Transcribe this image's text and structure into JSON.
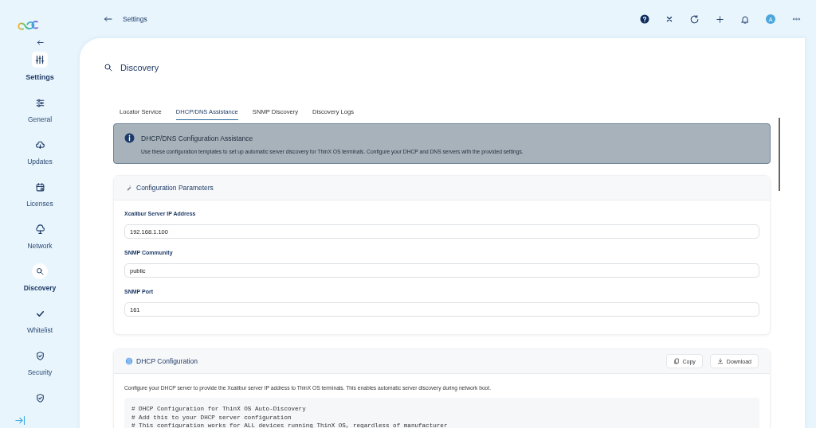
{
  "topbar": {
    "title": "Settings",
    "avatar": "A"
  },
  "sidebar": {
    "heading": "Settings",
    "items": [
      {
        "label": "General",
        "selected": false
      },
      {
        "label": "Updates",
        "selected": false
      },
      {
        "label": "Licenses",
        "selected": false
      },
      {
        "label": "Network",
        "selected": false
      },
      {
        "label": "Discovery",
        "selected": true
      },
      {
        "label": "Whitelist",
        "selected": false
      },
      {
        "label": "Security",
        "selected": false
      },
      {
        "selected": false
      }
    ]
  },
  "page": {
    "title": "Discovery"
  },
  "tabs": [
    {
      "label": "Locator Service",
      "selected": false
    },
    {
      "label": "DHCP/DNS Assistance",
      "selected": true
    },
    {
      "label": "SNMP Discovery",
      "selected": false
    },
    {
      "label": "Discovery Logs",
      "selected": false
    }
  ],
  "banner": {
    "title": "DHCP/DNS Configuration Assistance",
    "text": "Use these configuration templates to set up automatic server discovery for ThinX OS terminals. Configure your DHCP and DNS servers with the provided settings."
  },
  "config_card": {
    "title": "Configuration Parameters",
    "fields": [
      {
        "label": "Xcalibur Server IP Address",
        "value": "192.168.1.100"
      },
      {
        "label": "SNMP Community",
        "value": "public"
      },
      {
        "label": "SNMP Port",
        "value": "161"
      }
    ]
  },
  "dhcp_card": {
    "title": "DHCP Configuration",
    "buttons": [
      "Copy",
      "Download"
    ],
    "description": "Configure your DHCP server to provide the Xcalibur server IP address to ThinX OS terminals. This enables automatic server discovery during network boot.",
    "code": [
      "# DHCP Configuration for ThinX OS Auto-Discovery",
      "# Add this to your DHCP server configuration",
      "# This configuration works for ALL devices running ThinX OS, regardless of manufacturer"
    ]
  }
}
